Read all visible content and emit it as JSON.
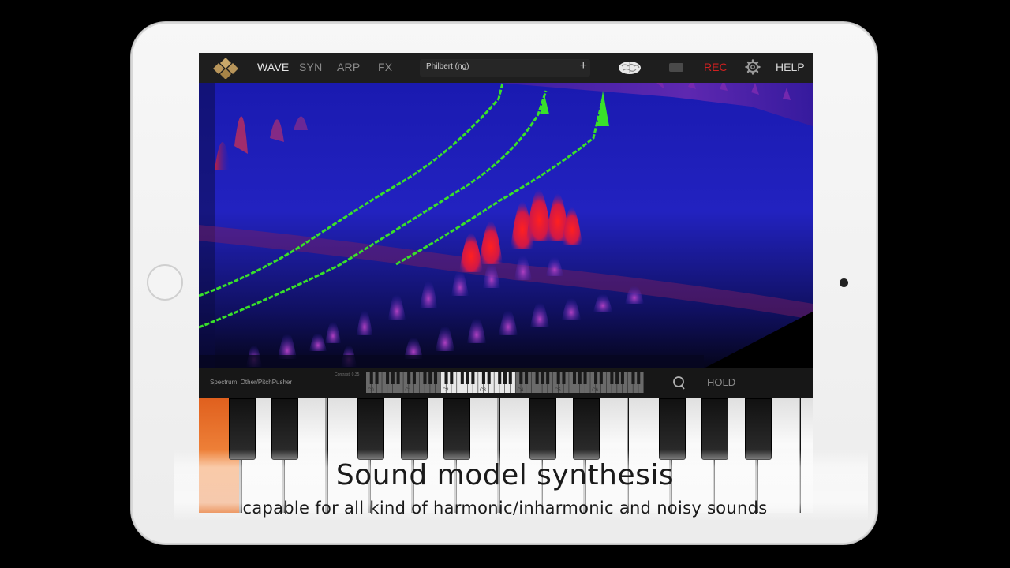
{
  "app": {
    "tabs": [
      {
        "label": "WAVE",
        "active": true
      },
      {
        "label": "SYN",
        "active": false
      },
      {
        "label": "ARP",
        "active": false
      },
      {
        "label": "FX",
        "active": false
      }
    ],
    "preset_name": "Philbert (ng)",
    "preset_add": "+",
    "rec_label": "REC",
    "help_label": "HELP",
    "colors": {
      "rec": "#d02020",
      "pressed_key": "#f07a30",
      "spectrum_trace": "#39e02a",
      "spectrum_peak": "#ff2020"
    }
  },
  "control_bar": {
    "spectrum_label": "Spectrum: Other/PitchPusher",
    "tiny_label": "Contrast: 0.35",
    "octave_labels": [
      "C0",
      "C1",
      "C2",
      "C3",
      "C4",
      "C5",
      "C6"
    ],
    "hold_label": "HOLD",
    "q_icon": "search-icon"
  },
  "keyboard": {
    "pressed_white_key_index": 0
  },
  "caption": {
    "title": "Sound model synthesis",
    "subtitle": "capable for all kind of harmonic/inharmonic and noisy sounds"
  }
}
